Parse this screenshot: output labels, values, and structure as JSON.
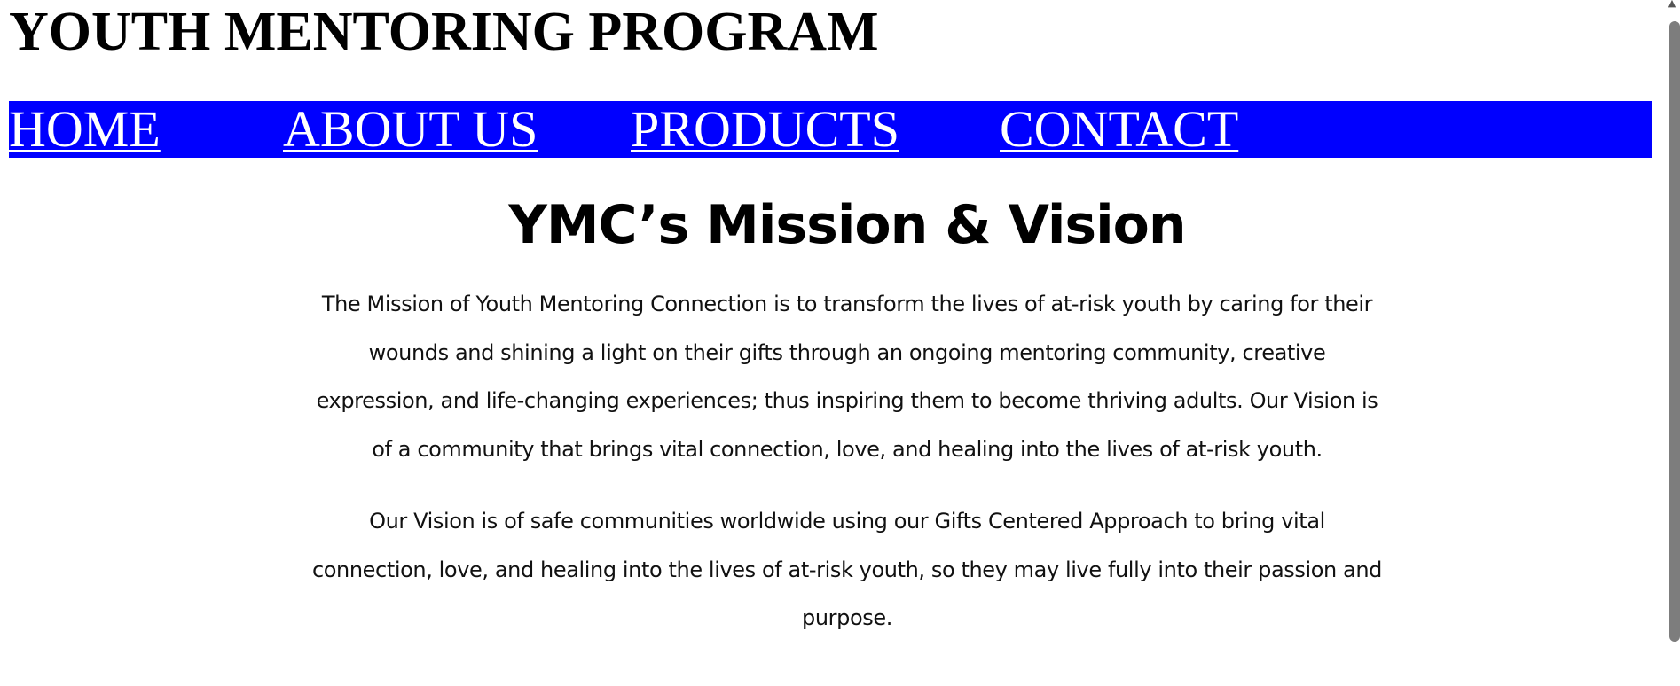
{
  "header": {
    "site_title": "YOUTH MENTORING PROGRAM"
  },
  "nav": {
    "background_color": "#0000ff",
    "link_color": "#ffffff",
    "items": [
      {
        "label": "HOME"
      },
      {
        "label": "ABOUT US"
      },
      {
        "label": "PRODUCTS"
      },
      {
        "label": "CONTACT"
      }
    ]
  },
  "main": {
    "heading": "YMC’s Mission & Vision",
    "paragraphs": [
      "The Mission of Youth Mentoring Connection is to transform the lives of at-risk youth by caring for their wounds and shining a light on their gifts through an ongoing mentoring community, creative expression, and life-changing experiences; thus inspiring them to become thriving adults. Our Vision is of a community that brings vital connection, love, and healing into the lives of at-risk youth.",
      "Our Vision is of safe communities worldwide using our Gifts Centered Approach to bring vital connection, love, and healing into the lives of at-risk youth, so they may live fully into their passion and purpose."
    ]
  },
  "scrollbar": {
    "up_arrow_icon": "chevron-up-icon"
  }
}
